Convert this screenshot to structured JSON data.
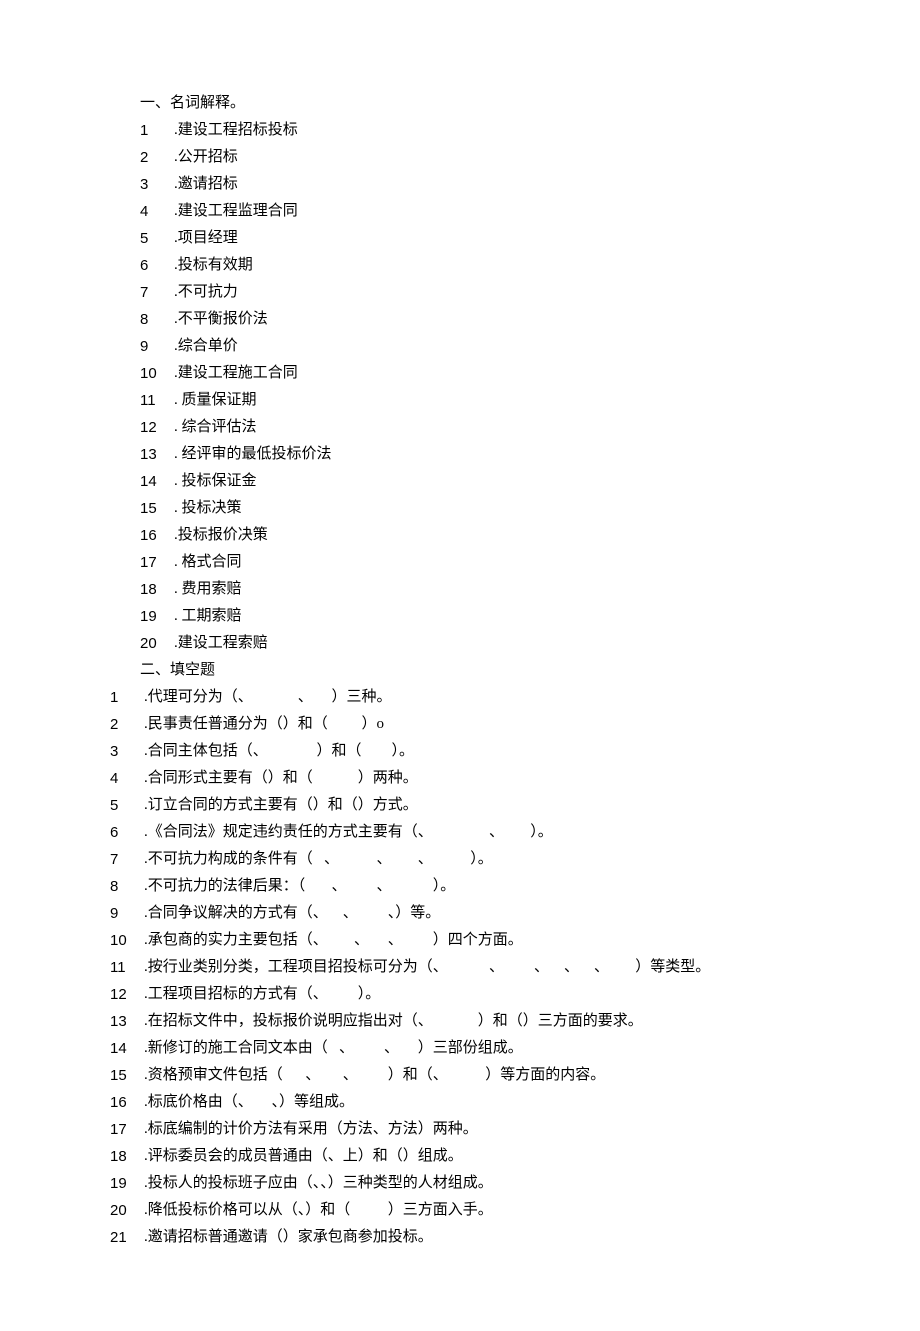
{
  "section1": {
    "heading": "一、名词解释。",
    "items": [
      {
        "num": "1",
        "text": ".建设工程招标投标"
      },
      {
        "num": "2",
        "text": ".公开招标"
      },
      {
        "num": "3",
        "text": ".邀请招标"
      },
      {
        "num": "4",
        "text": ".建设工程监理合同"
      },
      {
        "num": "5",
        "text": ".项目经理"
      },
      {
        "num": "6",
        "text": ".投标有效期"
      },
      {
        "num": "7",
        "text": ".不可抗力"
      },
      {
        "num": "8",
        "text": ".不平衡报价法"
      },
      {
        "num": "9",
        "text": ".综合单价"
      },
      {
        "num": "10",
        "text": ".建设工程施工合同"
      },
      {
        "num": "11",
        "text": ". 质量保证期"
      },
      {
        "num": "12",
        "text": ". 综合评估法"
      },
      {
        "num": "13",
        "text": ". 经评审的最低投标价法"
      },
      {
        "num": "14",
        "text": ". 投标保证金"
      },
      {
        "num": "15",
        "text": ". 投标决策"
      },
      {
        "num": "16",
        "text": ".投标报价决策"
      },
      {
        "num": "17",
        "text": ". 格式合同"
      },
      {
        "num": "18",
        "text": ". 费用索赔"
      },
      {
        "num": "19",
        "text": ". 工期索赔"
      },
      {
        "num": "20",
        "text": ".建设工程索赔"
      }
    ]
  },
  "section2": {
    "heading": "二、填空题",
    "items": [
      {
        "num": "1",
        "text": ".代理可分为（、            、     ）三种。"
      },
      {
        "num": "2",
        "text": ".民事责任普通分为（）和（         ）o"
      },
      {
        "num": "3",
        "text": ".合同主体包括（、             ）和（        ）。"
      },
      {
        "num": "4",
        "text": ".合同形式主要有（）和（            ）两种。"
      },
      {
        "num": "5",
        "text": ".订立合同的方式主要有（）和（）方式。"
      },
      {
        "num": "6",
        "text": ".《合同法》规定违约责任的方式主要有（、               、       ）。"
      },
      {
        "num": "7",
        "text": ".不可抗力构成的条件有（   、          、       、          ）。"
      },
      {
        "num": "8",
        "text": ".不可抗力的法律后果：（       、        、           ）。"
      },
      {
        "num": "9",
        "text": ".合同争议解决的方式有（、    、        、）等。"
      },
      {
        "num": "10",
        "text": ".承包商的实力主要包括（、       、     、        ）四个方面。"
      },
      {
        "num": "11",
        "text": ".按行业类别分类，工程项目招投标可分为（、           、        、    、    、       ）等类型。"
      },
      {
        "num": "12",
        "text": ".工程项目招标的方式有（、        ）。"
      },
      {
        "num": "13",
        "text": ".在招标文件中，投标报价说明应指出对（、            ）和（）三方面的要求。"
      },
      {
        "num": "14",
        "text": ".新修订的施工合同文本由（   、        、     ）三部份组成。"
      },
      {
        "num": "15",
        "text": ".资格预审文件包括（      、      、        ）和（、          ）等方面的内容。"
      },
      {
        "num": "16",
        "text": ".标底价格由（、     、）等组成。"
      },
      {
        "num": "17",
        "text": ".标底编制的计价方法有采用（方法、方法）两种。"
      },
      {
        "num": "18",
        "text": ".评标委员会的成员普通由（、上）和（）组成。"
      },
      {
        "num": "19",
        "text": ".投标人的投标班子应由（、、）三种类型的人材组成。"
      },
      {
        "num": "20",
        "text": ".降低投标价格可以从（、）和（          ）三方面入手。"
      },
      {
        "num": "21",
        "text": ".邀请招标普通邀请（）家承包商参加投标。"
      }
    ]
  }
}
